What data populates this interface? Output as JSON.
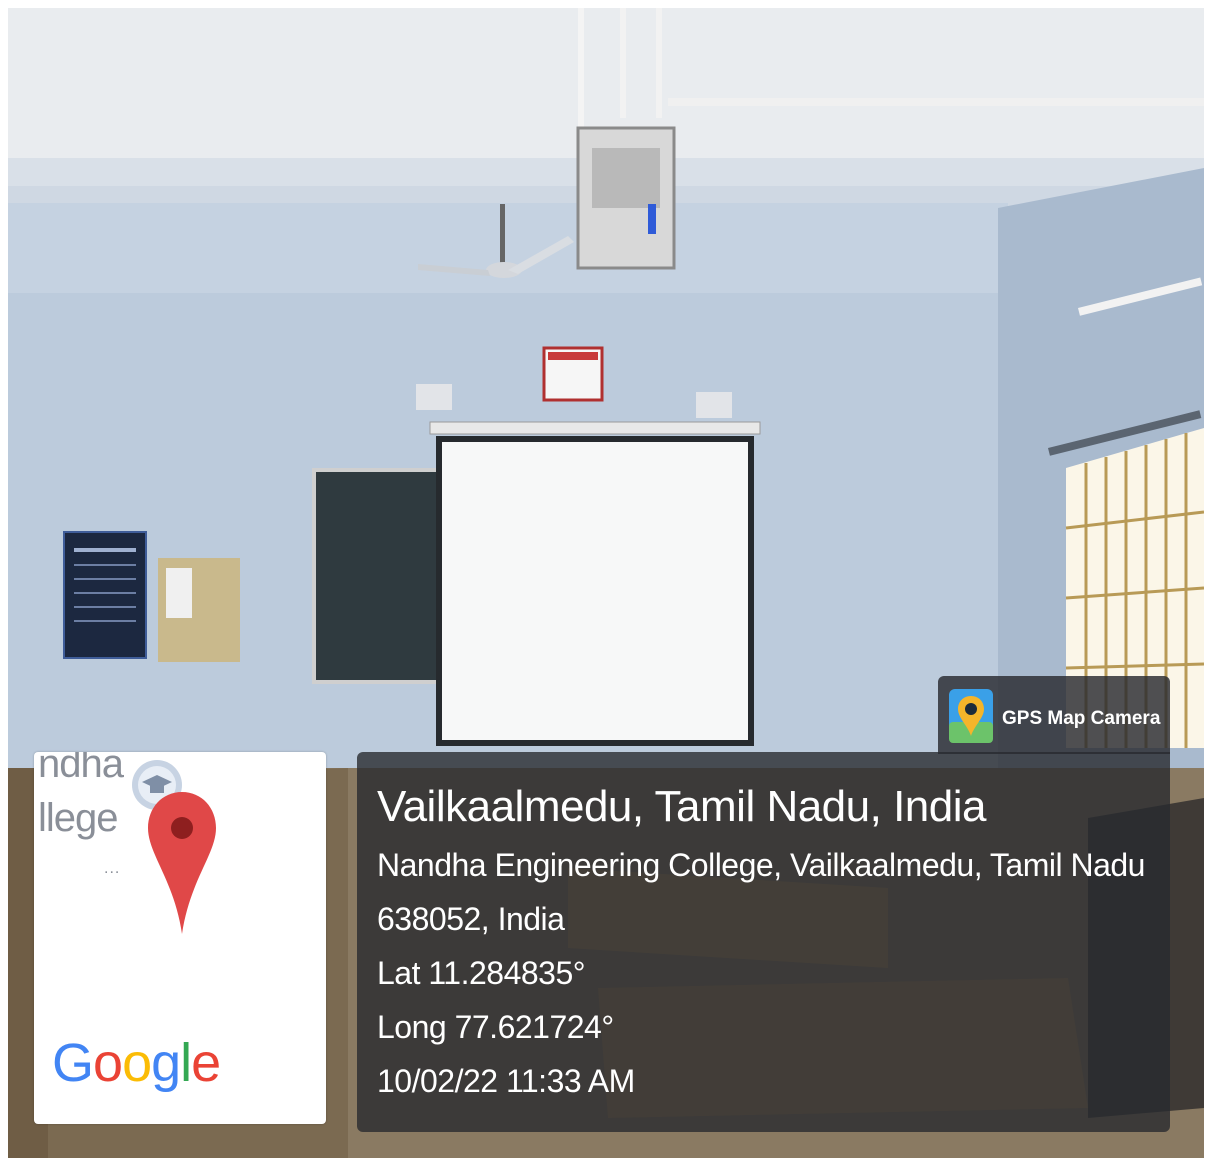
{
  "map_card": {
    "place_line_1": "ndha",
    "place_line_2": "llege",
    "ellipsis": "...",
    "logo_letters": [
      {
        "char": "G",
        "color": "#4285F4"
      },
      {
        "char": "o",
        "color": "#EA4335"
      },
      {
        "char": "o",
        "color": "#FBBC05"
      },
      {
        "char": "g",
        "color": "#4285F4"
      },
      {
        "char": "l",
        "color": "#34A853"
      },
      {
        "char": "e",
        "color": "#EA4335"
      }
    ],
    "pin_color": "#E04848"
  },
  "gps_badge": {
    "label": "GPS Map Camera"
  },
  "location": {
    "title": "Vailkaalmedu, Tamil Nadu, India",
    "address_line_1": "Nandha Engineering College, Vailkaalmedu, Tamil Nadu",
    "address_line_2": "638052, India",
    "latitude": "Lat 11.284835°",
    "longitude": "Long 77.621724°",
    "timestamp": "10/02/22 11:33 AM"
  },
  "overlay_color": "#282A30"
}
